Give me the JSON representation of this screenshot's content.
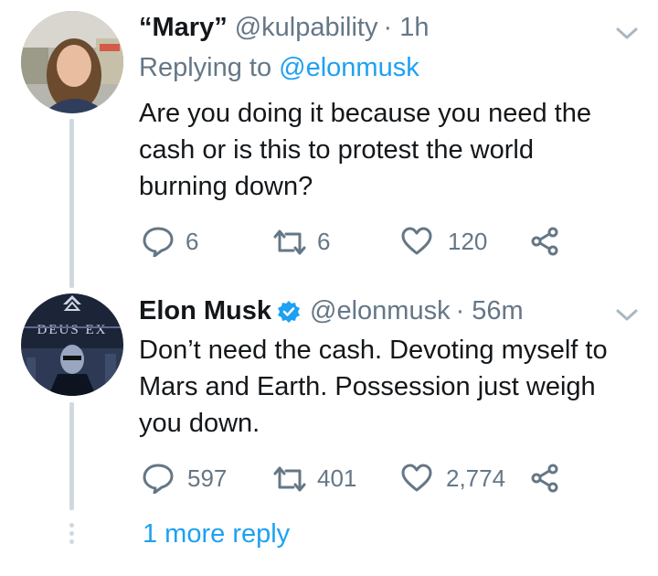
{
  "tweets": [
    {
      "name": "“Mary”",
      "handle": "@kulpability",
      "time": "· 1h",
      "replying_prefix": "Replying to ",
      "replying_to": "@elonmusk",
      "body": "Are you doing it because you need the cash or is this to protest the world burning down?",
      "replies": "6",
      "retweets": "6",
      "likes": "120"
    },
    {
      "name": "Elon Musk",
      "handle": "@elonmusk",
      "time": "· 56m",
      "verified": true,
      "body": "Don’t need the cash. Devoting myself to Mars and Earth. Possession just weigh you down.",
      "replies": "597",
      "retweets": "401",
      "likes": "2,774",
      "avatar_text": "DEUS EX"
    }
  ],
  "more_replies": "1 more reply",
  "colors": {
    "link": "#1da1f2",
    "muted": "#657786",
    "text": "#14171a",
    "verified": "#1da1f2"
  },
  "icons": [
    "reply-icon",
    "retweet-icon",
    "like-icon",
    "share-icon",
    "chevron-down-icon",
    "verified-badge-icon"
  ]
}
